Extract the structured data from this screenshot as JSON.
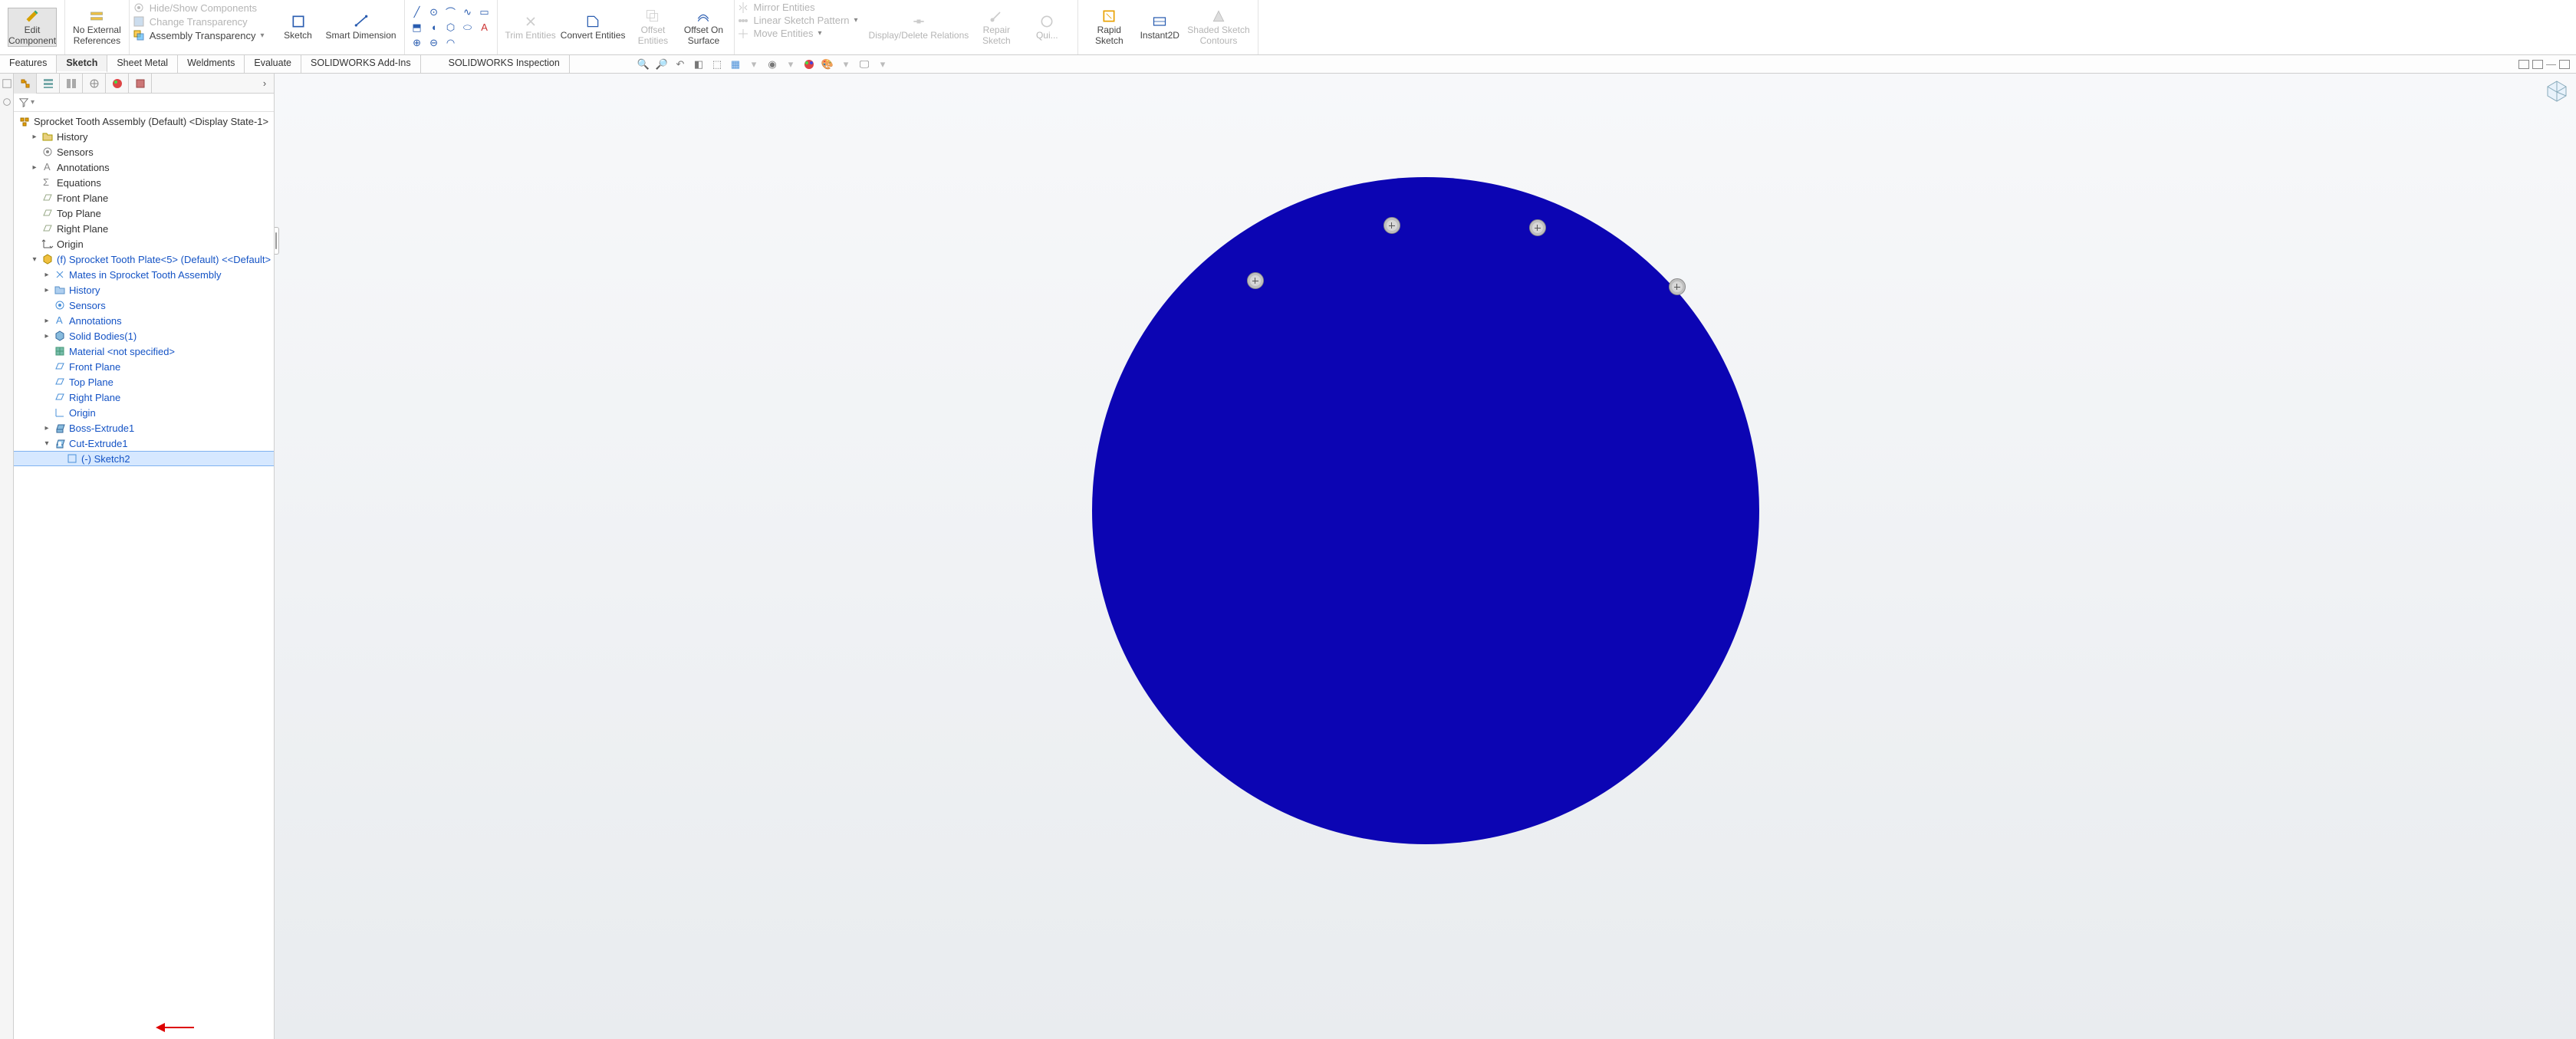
{
  "ribbon": {
    "edit_component": "Edit\nComponent",
    "no_ext_refs": "No External\nReferences",
    "hide_show": "Hide/Show Components",
    "change_trans": "Change Transparency",
    "assembly_trans": "Assembly Transparency",
    "sketch": "Sketch",
    "smart_dim": "Smart Dimension",
    "trim": "Trim Entities",
    "convert": "Convert Entities",
    "offset": "Offset\nEntities",
    "offset_surface": "Offset On\nSurface",
    "mirror": "Mirror Entities",
    "linear_pattern": "Linear Sketch Pattern",
    "move": "Move Entities",
    "display_relations": "Display/Delete Relations",
    "repair": "Repair\nSketch",
    "quick": "Qui...",
    "rapid": "Rapid\nSketch",
    "instant2d": "Instant2D",
    "shaded": "Shaded Sketch\nContours"
  },
  "tabs": {
    "features": "Features",
    "sketch": "Sketch",
    "sheet_metal": "Sheet Metal",
    "weldments": "Weldments",
    "evaluate": "Evaluate",
    "addins": "SOLIDWORKS Add-Ins",
    "inspection": "SOLIDWORKS Inspection"
  },
  "tree": {
    "root": "Sprocket Tooth Assembly (Default) <Display State-1>",
    "history": "History",
    "sensors": "Sensors",
    "annotations": "Annotations",
    "equations": "Equations",
    "front_plane": "Front Plane",
    "top_plane": "Top Plane",
    "right_plane": "Right Plane",
    "origin": "Origin",
    "part": "(f) Sprocket Tooth Plate<5> (Default) <<Default>",
    "mates": "Mates in Sprocket Tooth Assembly",
    "p_history": "History",
    "p_sensors": "Sensors",
    "p_annotations": "Annotations",
    "solid_bodies": "Solid Bodies(1)",
    "material": "Material <not specified>",
    "p_front": "Front Plane",
    "p_top": "Top Plane",
    "p_right": "Right Plane",
    "p_origin": "Origin",
    "boss": "Boss-Extrude1",
    "cut": "Cut-Extrude1",
    "sketch2": "(-) Sketch2"
  }
}
